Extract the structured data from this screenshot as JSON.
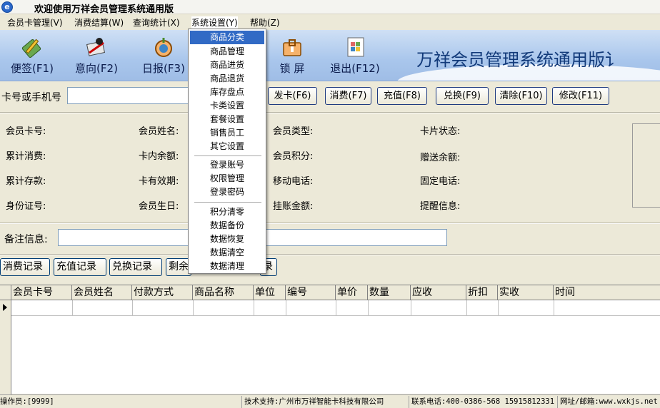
{
  "window": {
    "title": "欢迎使用万祥会员管理系统通用版"
  },
  "menubar": [
    {
      "label": "会员卡管理(V)"
    },
    {
      "label": "消费结算(W)"
    },
    {
      "label": "查询统计(X)"
    },
    {
      "label": "系统设置(Y)"
    },
    {
      "label": "帮助(Z)"
    }
  ],
  "toolbar": {
    "buttons": [
      {
        "label": "便签(F1)",
        "icon": "note-pad-icon"
      },
      {
        "label": "意向(F2)",
        "icon": "intent-icon"
      },
      {
        "label": "日报(F3)",
        "icon": "daily-report-icon"
      },
      {
        "label": "锁  屏",
        "icon": "lock-screen-icon"
      },
      {
        "label": "退出(F12)",
        "icon": "exit-icon"
      }
    ],
    "banner": "万祥会员管理系统通用版讠"
  },
  "search": {
    "label": "卡号或手机号",
    "value": "",
    "buttons": [
      "发卡(F6)",
      "消费(F7)",
      "充值(F8)",
      "兑换(F9)",
      "清除(F10)",
      "修改(F11)"
    ]
  },
  "info_labels": {
    "card_no": "会员卡号:",
    "name": "会员姓名:",
    "type": "会员类型:",
    "card_status": "卡片状态:",
    "total_spend": "累计消费:",
    "balance": "卡内余额:",
    "points": "会员积分:",
    "gift_balance": "赠送余额:",
    "total_deposit": "累计存款:",
    "validity": "卡有效期:",
    "mobile": "移动电话:",
    "phone": "固定电话:",
    "id_no": "身份证号:",
    "birthday": "会员生日:",
    "credit": "挂账金额:",
    "reminder": "提醒信息:"
  },
  "remark": {
    "label": "备注信息:",
    "value": ""
  },
  "records": {
    "tabs": [
      "消费记录",
      "充值记录",
      "兑换记录",
      "剩余",
      "录"
    ]
  },
  "grid": {
    "columns": [
      "会员卡号",
      "会员姓名",
      "付款方式",
      "商品名称",
      "单位",
      "编号",
      "单价",
      "数量",
      "应收",
      "折扣",
      "实收",
      "时间"
    ]
  },
  "dropdown": {
    "items": [
      "商品分类",
      "商品管理",
      "商品进货",
      "商品退货",
      "库存盘点",
      "卡类设置",
      "套餐设置",
      "销售员工",
      "其它设置",
      "登录账号",
      "权限管理",
      "登录密码",
      "积分清零",
      "数据备份",
      "数据恢复",
      "数据清空",
      "数据清理"
    ],
    "selected": "商品分类"
  },
  "statusbar": {
    "operator": "操作员:[9999]",
    "support": "技术支持:广州市万祥智能卡科技有限公司",
    "contact": "联系电话:400-0386-568 15915812331",
    "web": "网址/邮箱:www.wxkjs.net"
  },
  "colors": {
    "selection": "#316ac5",
    "toolbar": "#a9c6ec",
    "banner_text": "#123a7a"
  }
}
